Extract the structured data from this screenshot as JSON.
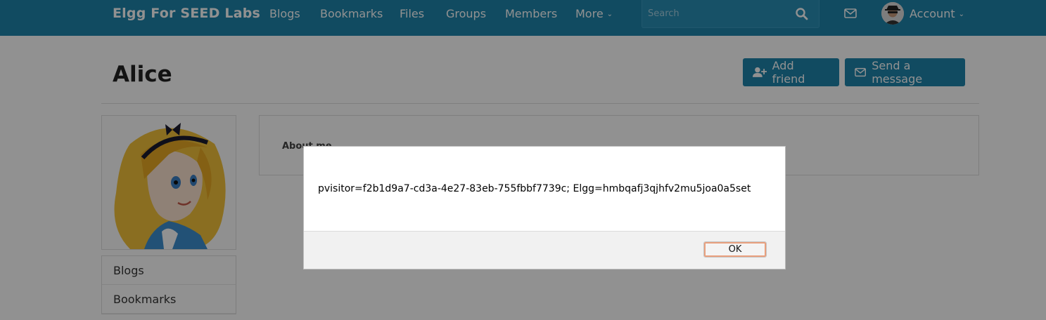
{
  "header": {
    "brand": "Elgg For SEED Labs",
    "nav": [
      "Blogs",
      "Bookmarks",
      "Files",
      "Groups",
      "Members"
    ],
    "more_label": "More",
    "search_placeholder": "Search",
    "account_label": "Account"
  },
  "profile": {
    "name": "Alice",
    "add_friend_label": "Add friend",
    "send_message_label": "Send a message",
    "about_label": "About me",
    "side_menu": [
      "Blogs",
      "Bookmarks"
    ]
  },
  "dialog": {
    "message": "pvisitor=f2b1d9a7-cd3a-4e27-83eb-755fbbf7739c; Elgg=hmbqafj3qjhfv2mu5joa0a5set",
    "ok_label": "OK"
  },
  "colors": {
    "topbar": "#1e84ab",
    "button": "#1e84ab"
  }
}
